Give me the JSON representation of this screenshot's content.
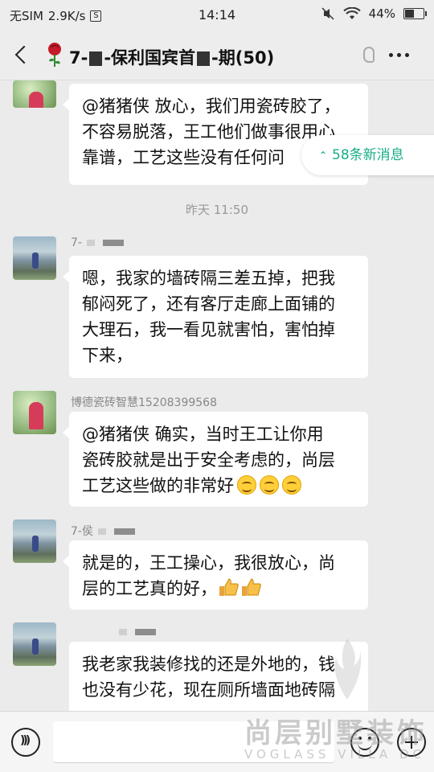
{
  "status_bar": {
    "carrier": "无SIM",
    "speed": "2.9K/s",
    "speed_icon": "S",
    "time": "14:14",
    "battery": "44%"
  },
  "header": {
    "title_prefix": "7-",
    "title_mid": "-保利国宾首",
    "title_suffix": "-期(50)"
  },
  "new_messages": "58条新消息",
  "timestamp": "昨天 11:50",
  "messages": [
    {
      "sender": "",
      "text": "@猪猪侠  放心，我们用瓷砖胶了，\n不容易脱落，王工他们做事很用心\n靠谱，工艺这些没有任何问"
    },
    {
      "sender": "7-",
      "text": "嗯，我家的墙砖隔三差五掉，把我\n郁闷死了，还有客厅走廊上面铺的\n大理石，我一看见就害怕，害怕掉\n下来，"
    },
    {
      "sender": "博德瓷砖智慧15208399568",
      "text": "@猪猪侠  确实，当时王工让你用\n瓷砖胶就是出于安全考虑的，尚层\n工艺这些做的非常好"
    },
    {
      "sender": "7-侯",
      "text": "就是的，王工操心，我很放心，尚\n层的工艺真的好，"
    },
    {
      "sender": "",
      "text": "我老家我装修找的还是外地的，钱\n也没有少花，现在厕所墙面地砖隔"
    }
  ],
  "watermark": {
    "cn": "尚层别墅装饰",
    "en": "VOGLASS VILLA DC"
  }
}
